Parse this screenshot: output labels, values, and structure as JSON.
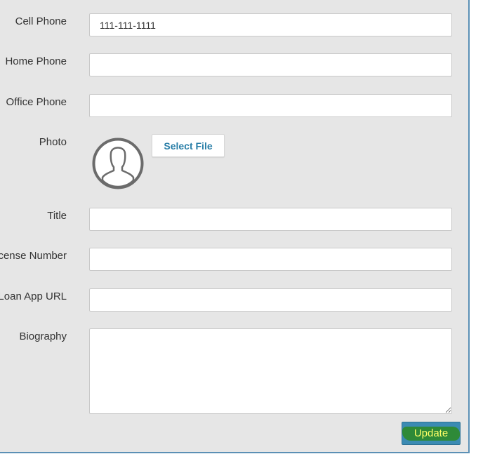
{
  "form": {
    "cell_phone": {
      "label": "Cell Phone",
      "value": "111-111-1111"
    },
    "home_phone": {
      "label": "Home Phone",
      "value": ""
    },
    "office_phone": {
      "label": "Office Phone",
      "value": ""
    },
    "photo": {
      "label": "Photo",
      "select_file_label": "Select File",
      "avatar_icon": "user-silhouette-icon"
    },
    "title": {
      "label": "Title",
      "value": ""
    },
    "license_number": {
      "label": "License Number",
      "value": ""
    },
    "loan_app_url": {
      "label": "Loan App URL",
      "value": ""
    },
    "biography": {
      "label": "Biography",
      "value": ""
    },
    "update_label": "Update"
  },
  "colors": {
    "panel_background": "#e6e6e6",
    "panel_border": "#5b90b5",
    "accent_text": "#2a7fa8",
    "update_button": "#3b8bb3",
    "update_text_highlight": "#ffff66",
    "highlight_mark": "#2e8a2a"
  }
}
